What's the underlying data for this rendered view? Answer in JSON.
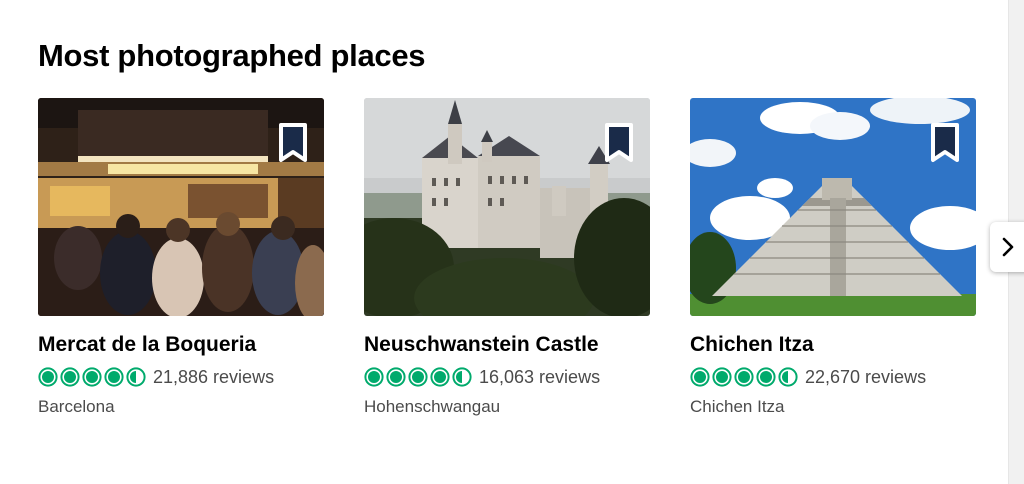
{
  "section": {
    "title": "Most photographed places"
  },
  "colors": {
    "rating_green": "#00aa6c",
    "bookmark": "#1a2b49"
  },
  "icons": {
    "save": "bookmark-icon",
    "rating": "rating-bubble-icon",
    "next": "chevron-right-icon"
  },
  "cards": [
    {
      "name": "Mercat de la Boqueria",
      "rating": 4.5,
      "reviews": "21,886 reviews",
      "location": "Barcelona"
    },
    {
      "name": "Neuschwanstein Castle",
      "rating": 4.5,
      "reviews": "16,063 reviews",
      "location": "Hohenschwangau"
    },
    {
      "name": "Chichen Itza",
      "rating": 4.5,
      "reviews": "22,670 reviews",
      "location": "Chichen Itza"
    }
  ]
}
